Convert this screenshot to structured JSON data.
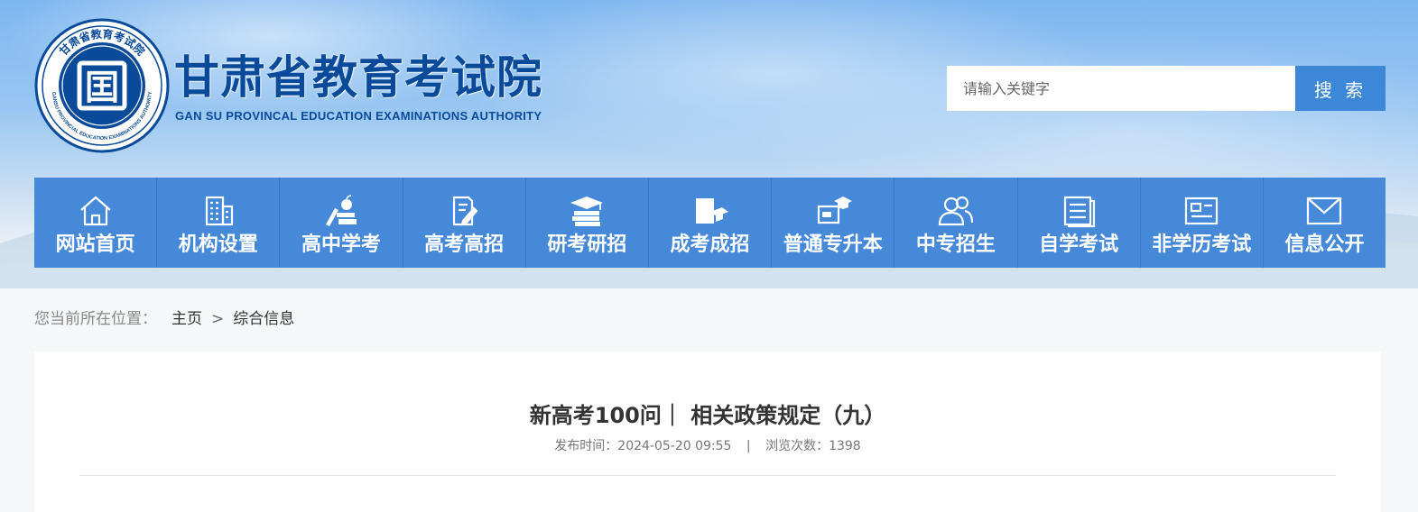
{
  "header": {
    "title": "甘肃省教育考试院",
    "subtitle": "GAN SU PROVINCAL EDUCATION EXAMINATIONS AUTHORITY",
    "emblem_text": "甘肃省教育考试院",
    "emblem_english": "GANSU PROVINCIAL EDUCATION EXAMINATIONS AUTHORITY",
    "emblem_glyph": "囯"
  },
  "search": {
    "placeholder": "请输入关键字",
    "value": "",
    "button_label": "搜 索"
  },
  "nav": {
    "items": [
      {
        "label": "网站首页",
        "icon": "home-icon"
      },
      {
        "label": "机构设置",
        "icon": "building-icon"
      },
      {
        "label": "高中学考",
        "icon": "books-apple-icon"
      },
      {
        "label": "高考高招",
        "icon": "document-pen-icon"
      },
      {
        "label": "研考研招",
        "icon": "graduation-cap-books-icon"
      },
      {
        "label": "成考成招",
        "icon": "book-cap-icon"
      },
      {
        "label": "普通专升本",
        "icon": "screen-cap-icon"
      },
      {
        "label": "中专招生",
        "icon": "users-icon"
      },
      {
        "label": "自学考试",
        "icon": "notebook-icon"
      },
      {
        "label": "非学历考试",
        "icon": "id-card-icon"
      },
      {
        "label": "信息公开",
        "icon": "mail-icon"
      }
    ]
  },
  "breadcrumb": {
    "prefix": "您当前所在位置：",
    "home": "主页",
    "separator": ">",
    "current": "综合信息"
  },
  "article": {
    "title": "新高考100问｜ 相关政策规定（九）",
    "publish_label": "发布时间：",
    "publish_time": "2024-05-20 09:55",
    "meta_separator": "|",
    "views_label": "浏览次数：",
    "views": "1398"
  },
  "colors": {
    "brand_blue": "#0a4a9a",
    "nav_blue": "#4689d9",
    "button_blue": "#3d87d8"
  }
}
